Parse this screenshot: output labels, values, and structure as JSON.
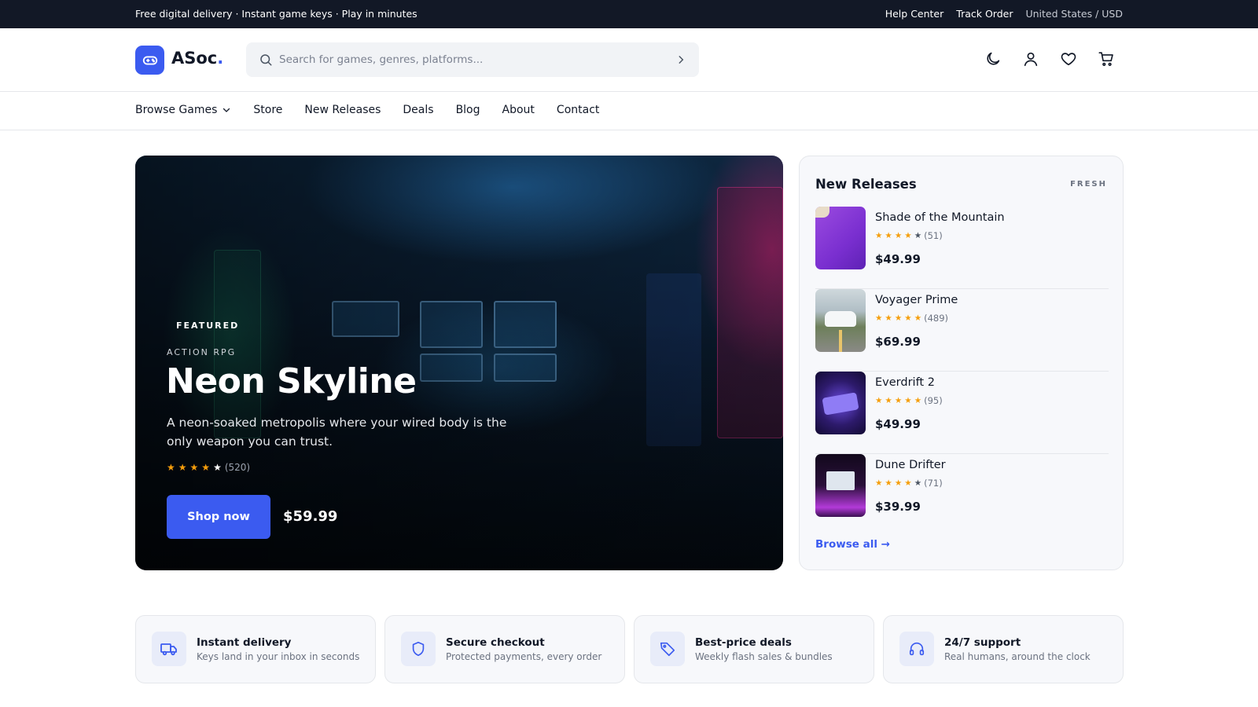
{
  "topbar": {
    "promo": "Free digital delivery · Instant game keys · Play in minutes",
    "help": "Help Center",
    "track": "Track Order",
    "region": "United States / USD"
  },
  "header": {
    "logo_text": "ASoc",
    "logo_dot": ".",
    "search_placeholder": "Search for games, genres, platforms...",
    "icons": [
      "moon-icon",
      "user-icon",
      "heart-icon",
      "cart-icon"
    ],
    "brand_color": "#3b5bf0"
  },
  "nav": {
    "items": [
      {
        "label": "Browse Games",
        "has_dropdown": true
      },
      {
        "label": "Store"
      },
      {
        "label": "New Releases"
      },
      {
        "label": "Deals"
      },
      {
        "label": "Blog"
      },
      {
        "label": "About"
      },
      {
        "label": "Contact"
      }
    ]
  },
  "hero": {
    "badge": "FEATURED",
    "genre": "ACTION  RPG",
    "title": "Neon Skyline",
    "description": "A neon-soaked metropolis where your wired body is the only weapon you can trust.",
    "rating": 4,
    "rating_count": "(520)",
    "cta": "Shop now",
    "price": "$59.99"
  },
  "new_releases": {
    "title": "New Releases",
    "tag": "FRESH",
    "items": [
      {
        "name": "Shade of the Mountain",
        "rating": 4,
        "count": "(51)",
        "price": "$49.99"
      },
      {
        "name": "Voyager Prime",
        "rating": 5,
        "count": "(489)",
        "price": "$69.99"
      },
      {
        "name": "Everdrift 2",
        "rating": 5,
        "count": "(95)",
        "price": "$49.99"
      },
      {
        "name": "Dune Drifter",
        "rating": 4,
        "count": "(71)",
        "price": "$39.99"
      }
    ],
    "browse_all": "Browse all →"
  },
  "features": [
    {
      "icon": "truck-icon",
      "title": "Instant delivery",
      "desc": "Keys land in your inbox in seconds"
    },
    {
      "icon": "shield-icon",
      "title": "Secure checkout",
      "desc": "Protected payments, every order"
    },
    {
      "icon": "tag-icon",
      "title": "Best-price deals",
      "desc": "Weekly flash sales & bundles"
    },
    {
      "icon": "headset-icon",
      "title": "24/7 support",
      "desc": "Real humans, around the clock"
    }
  ]
}
